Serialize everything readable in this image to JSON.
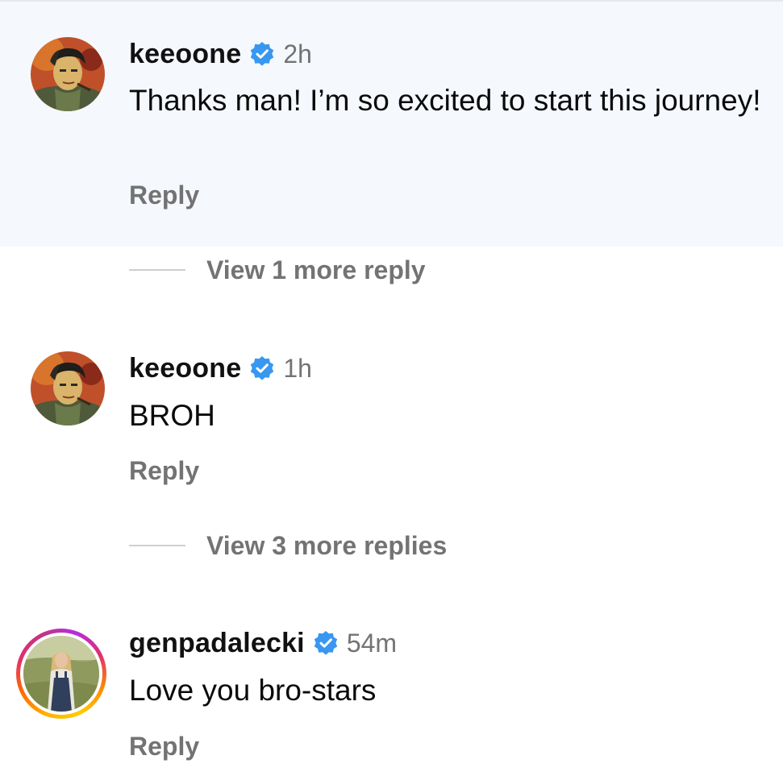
{
  "comments": [
    {
      "username": "keeoone",
      "verified": true,
      "time": "2h",
      "text": "Thanks man! I’m so excited to start this journey!",
      "reply_label": "Reply",
      "highlighted": true
    },
    {
      "username": "keeoone",
      "verified": true,
      "time": "1h",
      "text": "BROH",
      "reply_label": "Reply",
      "highlighted": false
    },
    {
      "username": "genpadalecki",
      "verified": true,
      "time": "54m",
      "text": "Love you bro-stars",
      "reply_label": "Reply",
      "highlighted": false,
      "story_ring": true
    }
  ],
  "view_more": [
    {
      "label": "View 1 more reply"
    },
    {
      "label": "View 3 more replies"
    }
  ],
  "colors": {
    "highlight_bg": "#f5f8fd",
    "verified_badge": "#3897f0",
    "muted_text": "#737373"
  },
  "icons": {
    "verified": "verified-badge-icon"
  }
}
